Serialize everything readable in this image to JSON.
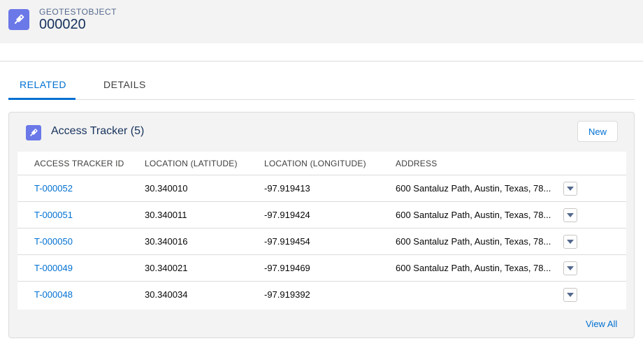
{
  "header": {
    "object_type": "GEOTESTOBJECT",
    "record_name": "000020",
    "icon": "key-icon"
  },
  "tabs": [
    {
      "label": "RELATED",
      "active": true
    },
    {
      "label": "DETAILS",
      "active": false
    }
  ],
  "related_list": {
    "title": "Access Tracker (5)",
    "icon": "key-icon",
    "new_label": "New",
    "view_all_label": "View All",
    "columns": [
      "ACCESS TRACKER ID",
      "LOCATION (LATITUDE)",
      "LOCATION (LONGITUDE)",
      "ADDRESS"
    ],
    "rows": [
      {
        "id": "T-000052",
        "lat": "30.340010",
        "lng": "-97.919413",
        "address": "600 Santaluz Path, Austin, Texas, 78..."
      },
      {
        "id": "T-000051",
        "lat": "30.340011",
        "lng": "-97.919424",
        "address": "600 Santaluz Path, Austin, Texas, 78..."
      },
      {
        "id": "T-000050",
        "lat": "30.340016",
        "lng": "-97.919454",
        "address": "600 Santaluz Path, Austin, Texas, 78..."
      },
      {
        "id": "T-000049",
        "lat": "30.340021",
        "lng": "-97.919469",
        "address": "600 Santaluz Path, Austin, Texas, 78..."
      },
      {
        "id": "T-000048",
        "lat": "30.340034",
        "lng": "-97.919392",
        "address": ""
      }
    ]
  },
  "colors": {
    "accent": "#0070d2",
    "icon_bg": "#6b78e8",
    "header_bg": "#f3f3f3"
  }
}
